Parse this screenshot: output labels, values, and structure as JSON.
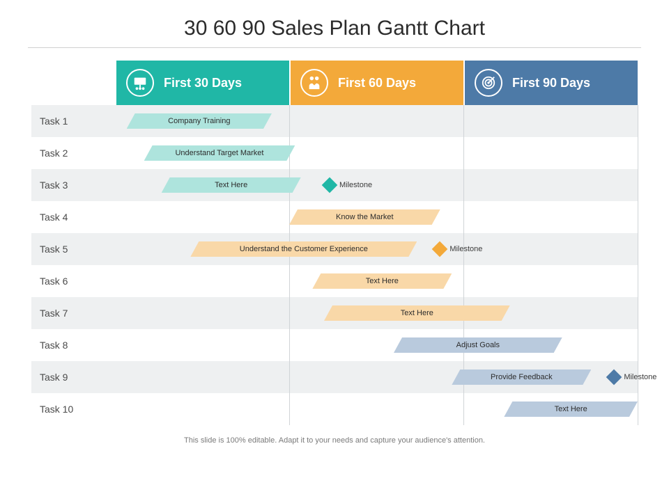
{
  "title": "30 60 90 Sales Plan Gantt Chart",
  "footer": "This slide is 100% editable. Adapt it to your needs and capture your audience's attention.",
  "phases": [
    {
      "label": "First 30 Days",
      "color": "teal",
      "icon": "presentation"
    },
    {
      "label": "First 60 Days",
      "color": "orange",
      "icon": "handshake"
    },
    {
      "label": "First 90 Days",
      "color": "blue",
      "icon": "target"
    }
  ],
  "milestone_label": "Milestone",
  "tasks": [
    {
      "label": "Task 1"
    },
    {
      "label": "Task 2"
    },
    {
      "label": "Task 3"
    },
    {
      "label": "Task 4"
    },
    {
      "label": "Task 5"
    },
    {
      "label": "Task 6"
    },
    {
      "label": "Task 7"
    },
    {
      "label": "Task 8"
    },
    {
      "label": "Task 9"
    },
    {
      "label": "Task 10"
    }
  ],
  "chart_data": {
    "type": "bar",
    "title": "30 60 90 Sales Plan Gantt Chart",
    "x_unit": "days",
    "xlim": [
      0,
      90
    ],
    "phase_boundaries": [
      0,
      30,
      60,
      90
    ],
    "categories": [
      "Task 1",
      "Task 2",
      "Task 3",
      "Task 4",
      "Task 5",
      "Task 6",
      "Task 7",
      "Task 8",
      "Task 9",
      "Task 10"
    ],
    "bars": [
      {
        "task": "Task 1",
        "label": "Company Training",
        "start": 2,
        "end": 27,
        "phase": 0,
        "color": "teal"
      },
      {
        "task": "Task 2",
        "label": "Understand Target Market",
        "start": 5,
        "end": 31,
        "phase": 0,
        "color": "teal"
      },
      {
        "task": "Task 3",
        "label": "Text Here",
        "start": 8,
        "end": 32,
        "phase": 0,
        "color": "teal"
      },
      {
        "task": "Task 4",
        "label": "Know the Market",
        "start": 30,
        "end": 56,
        "phase": 1,
        "color": "orange"
      },
      {
        "task": "Task 5",
        "label": "Understand the Customer Experience",
        "start": 13,
        "end": 52,
        "phase": 1,
        "color": "orange"
      },
      {
        "task": "Task 6",
        "label": "Text Here",
        "start": 34,
        "end": 58,
        "phase": 1,
        "color": "orange"
      },
      {
        "task": "Task 7",
        "label": "Text Here",
        "start": 36,
        "end": 68,
        "phase": 1,
        "color": "orange"
      },
      {
        "task": "Task 8",
        "label": "Adjust Goals",
        "start": 48,
        "end": 77,
        "phase": 2,
        "color": "blue"
      },
      {
        "task": "Task 9",
        "label": "Provide Feedback",
        "start": 58,
        "end": 82,
        "phase": 2,
        "color": "blue"
      },
      {
        "task": "Task 10",
        "label": "Text Here",
        "start": 67,
        "end": 90,
        "phase": 2,
        "color": "blue"
      }
    ],
    "milestones": [
      {
        "task": "Task 3",
        "at": 36,
        "label": "Milestone",
        "color": "teal"
      },
      {
        "task": "Task 5",
        "at": 55,
        "label": "Milestone",
        "color": "orange"
      },
      {
        "task": "Task 9",
        "at": 85,
        "label": "Milestone",
        "color": "blue"
      }
    ]
  }
}
